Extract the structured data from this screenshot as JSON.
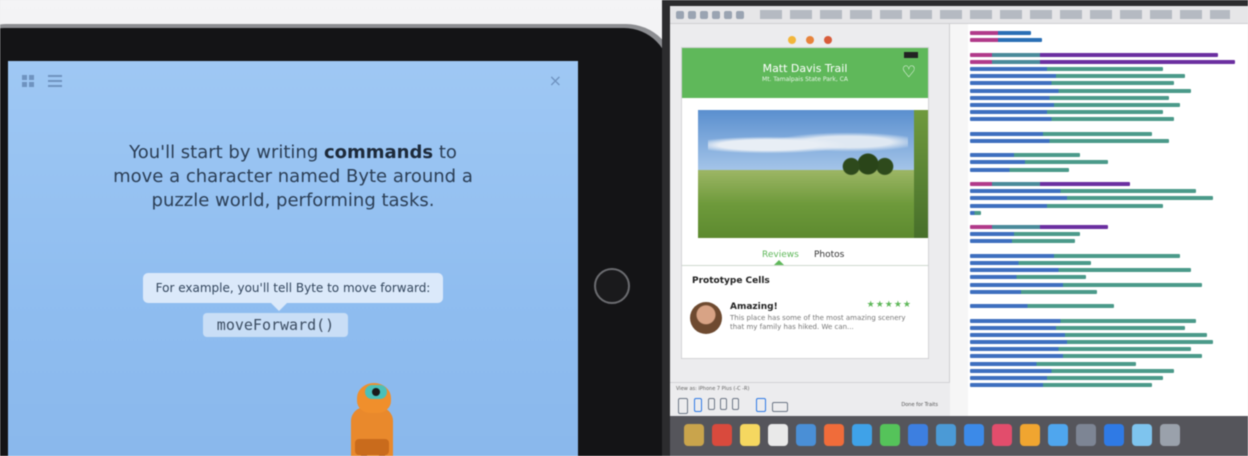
{
  "ipad": {
    "intro_line1_prefix": "You'll start by writing ",
    "intro_bold": "commands",
    "intro_line1_suffix": " to",
    "intro_line2": "move a character named Byte around a",
    "intro_line3": "puzzle world, performing tasks.",
    "example_bubble": "For example, you'll tell Byte to move forward:",
    "code_example": "moveForward()",
    "close_glyph": "×"
  },
  "xcode": {
    "nav_title": "Matt Davis Trail",
    "nav_subtitle": "Mt. Tamalpais State Park, CA",
    "tabs": [
      "Reviews",
      "Photos"
    ],
    "section_header": "Prototype Cells",
    "review_title": "Amazing!",
    "review_stars": "★★★★★",
    "review_text": "This place has some of the most amazing scenery that my family has hiked. We can...",
    "view_as": "View as: iPhone 7 Plus (-C -R)",
    "done_label": "Done for Traits"
  },
  "colors": {
    "ipad_screen": "#9fc8f4",
    "nav_green": "#5fb85a",
    "byte_orange": "#f08f2c"
  },
  "icons": [
    "grid-icon",
    "list-icon",
    "close-icon",
    "heart-icon",
    "home-button"
  ]
}
